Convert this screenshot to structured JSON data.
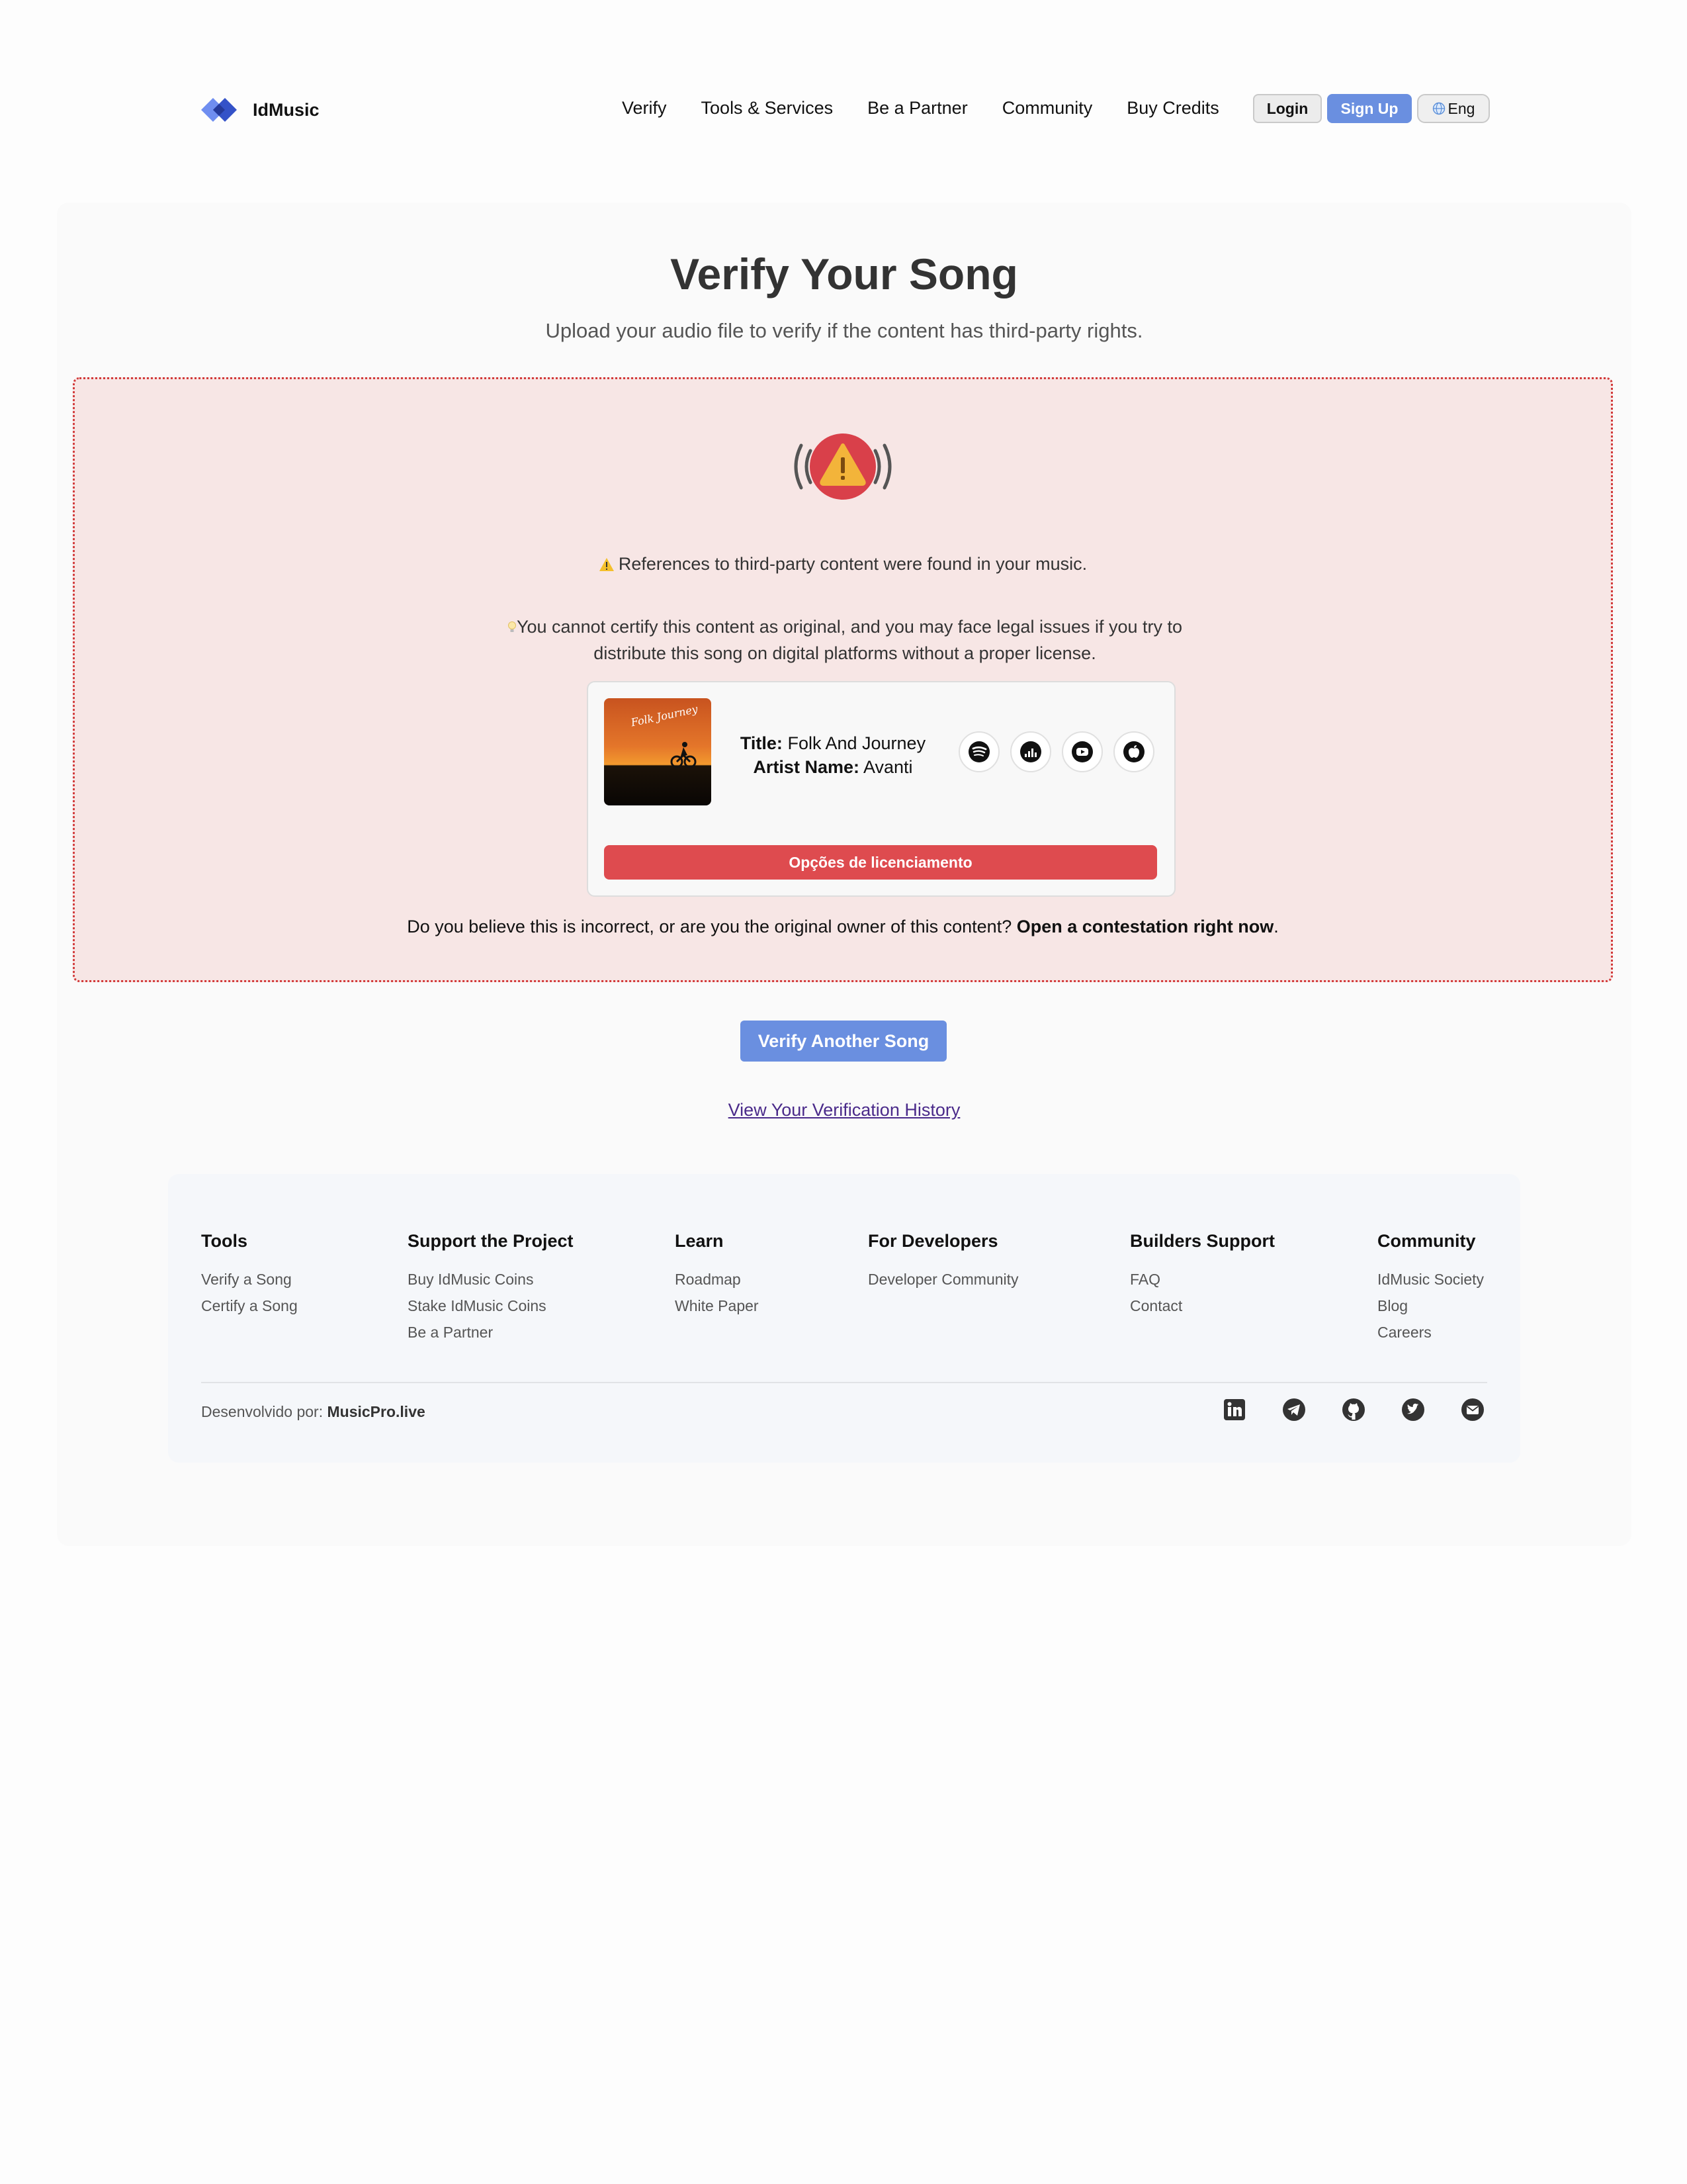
{
  "brand": {
    "name": "IdMusic"
  },
  "nav": [
    {
      "label": "Verify"
    },
    {
      "label": "Tools & Services"
    },
    {
      "label": "Be a Partner"
    },
    {
      "label": "Community"
    },
    {
      "label": "Buy Credits"
    }
  ],
  "auth": {
    "login_label": "Login",
    "signup_label": "Sign Up",
    "language": "Eng"
  },
  "main": {
    "title": "Verify Your Song",
    "subtitle": "Upload your audio file to verify if the content has third-party rights."
  },
  "alert": {
    "references_text": "References to third-party content were found in your music.",
    "warning_text": "You cannot certify this content as original, and you may face legal issues if you try to distribute this song on digital platforms without a proper license.",
    "contest_prefix": "Do you believe this is incorrect, or are you the original owner of this content?",
    "contest_link": "Open a contestation right now",
    "contest_suffix": "."
  },
  "song": {
    "cover_text": "Folk Journey",
    "title_label": "Title:",
    "title": "Folk And Journey",
    "artist_label": "Artist Name:",
    "artist": "Avanti",
    "platforms": [
      "spotify-icon",
      "deezer-icon",
      "youtube-icon",
      "apple-music-icon"
    ],
    "license_button": "Opções de licenciamento"
  },
  "actions": {
    "verify_another": "Verify Another Song",
    "history_link": "View Your Verification History"
  },
  "footer": {
    "columns": [
      {
        "title": "Tools",
        "links": [
          "Verify a Song",
          "Certify a Song"
        ]
      },
      {
        "title": "Support the Project",
        "links": [
          "Buy IdMusic Coins",
          "Stake IdMusic Coins",
          "Be a Partner"
        ]
      },
      {
        "title": "Learn",
        "links": [
          "Roadmap",
          "White Paper"
        ]
      },
      {
        "title": "For Developers",
        "links": [
          "Developer Community"
        ]
      },
      {
        "title": "Builders Support",
        "links": [
          "FAQ",
          "Contact"
        ]
      },
      {
        "title": "Community",
        "links": [
          "IdMusic Society",
          "Blog",
          "Careers"
        ]
      }
    ],
    "credit_prefix": "Desenvolvido por:",
    "credit_name": "MusicPro.live",
    "socials": [
      "linkedin-icon",
      "telegram-icon",
      "github-icon",
      "twitter-icon",
      "email-icon"
    ]
  },
  "colors": {
    "accent_blue": "#6a8fe0",
    "alert_bg": "#f7e6e5",
    "alert_border": "#d23a3a",
    "license_red": "#de4b4f"
  }
}
